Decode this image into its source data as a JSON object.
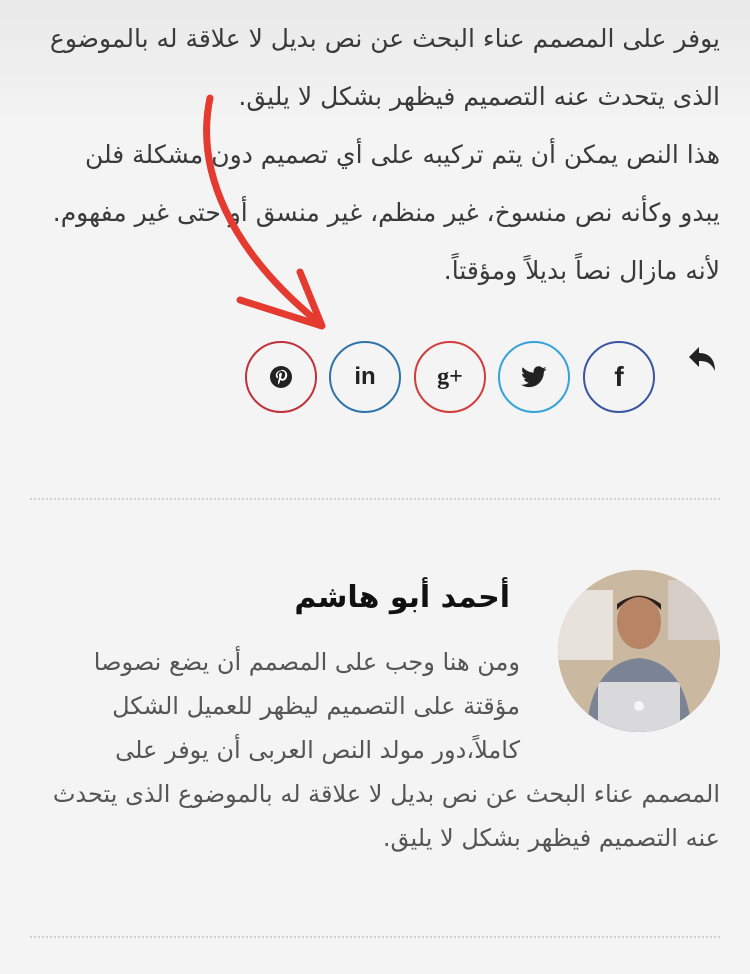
{
  "article": {
    "paragraph_1": "يوفر على المصمم عناء البحث عن نص بديل لا علاقة له بالموضوع الذى يتحدث عنه التصميم فيظهر بشكل لا يليق.",
    "paragraph_2": "هذا النص يمكن أن يتم تركيبه على أي تصميم دون مشكلة فلن يبدو وكأنه نص منسوخ، غير منظم، غير منسق أو حتى غير مفهوم. لأنه مازال نصاً بديلاً ومؤقتاً."
  },
  "share": {
    "buttons": [
      {
        "network": "pinterest",
        "icon": "pinterest-icon",
        "color": "#c0313a"
      },
      {
        "network": "linkedin",
        "icon": "linkedin-icon",
        "color": "#2f74a8",
        "glyph": "in"
      },
      {
        "network": "google-plus",
        "icon": "google-plus-icon",
        "color": "#d23c3c",
        "glyph": "g+"
      },
      {
        "network": "twitter",
        "icon": "twitter-icon",
        "color": "#35a3d8"
      },
      {
        "network": "facebook",
        "icon": "facebook-icon",
        "color": "#3a56a1",
        "glyph": "f"
      }
    ],
    "reply_icon": "reply-icon"
  },
  "author": {
    "name": "أحمد أبو هاشم",
    "bio_lines": [
      "ومن هنا وجب على المصمم أن يضع نصوصا",
      "مؤقتة على التصميم ليظهر للعميل الشكل",
      "كاملاً،دور مولد النص العربى أن يوفر على",
      "المصمم عناء البحث عن نص بديل لا علاقة له بالموضوع الذى يتحدث",
      "عنه التصميم فيظهر بشكل لا يليق."
    ],
    "avatar_icon": "author-avatar"
  },
  "annotation": {
    "color": "#e53a2f"
  }
}
